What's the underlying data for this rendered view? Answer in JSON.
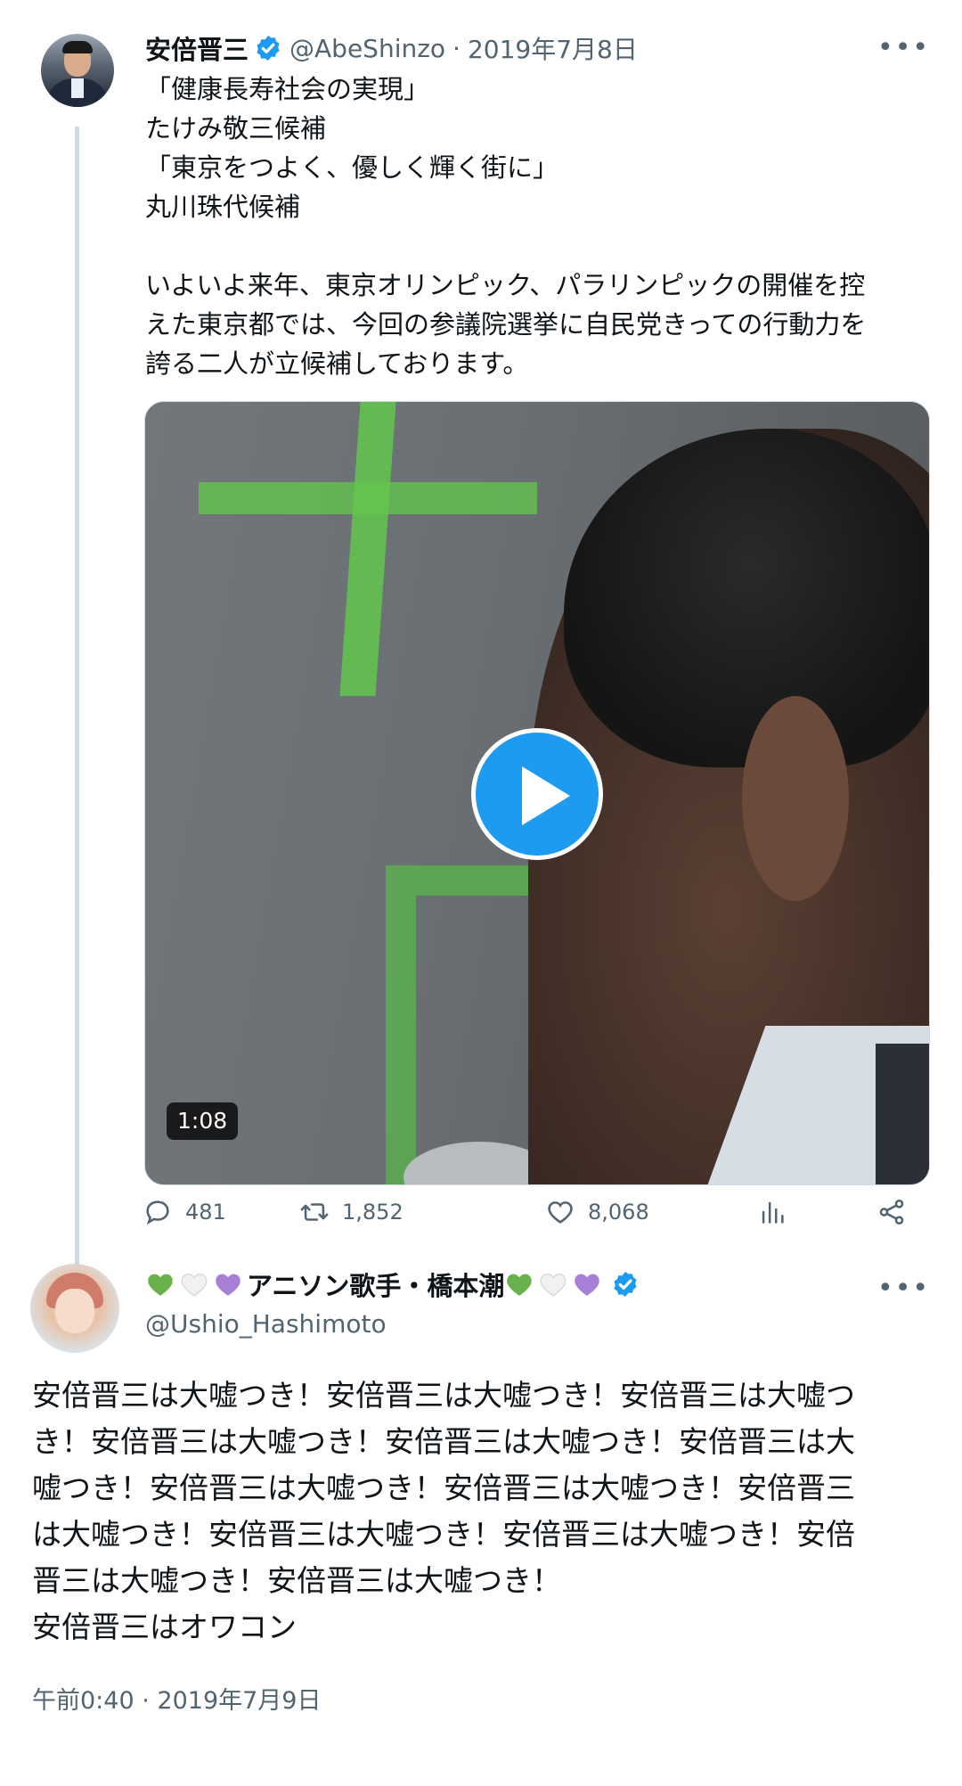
{
  "tweet1": {
    "author": {
      "name": "安倍晋三",
      "handle": "@AbeShinzo",
      "verified": true
    },
    "date": "2019年7月8日",
    "more_icon": "ellipsis-icon",
    "text_lines": [
      "「健康長寿社会の実現」",
      "たけみ敬三候補",
      "「東京をつよく、優しく輝く街に」",
      "丸川珠代候補",
      "",
      "いよいよ来年、東京オリンピック、パラリンピックの開催を控",
      "えた東京都では、今回の参議院選挙に自民党きっての行動力を",
      "誇る二人が立候補しております。"
    ],
    "video": {
      "duration": "1:08",
      "play_icon": "play-icon"
    },
    "actions": {
      "replies": "481",
      "retweets": "1,852",
      "likes": "8,068"
    }
  },
  "tweet2": {
    "author": {
      "name": "アニソン歌手・橋本潮",
      "name_emojis_before": [
        "green-heart",
        "white-heart",
        "purple-heart"
      ],
      "name_emojis_after": [
        "green-heart",
        "white-heart",
        "purple-heart"
      ],
      "handle": "@Ushio_Hashimoto",
      "verified": true
    },
    "text_lines": [
      "安倍晋三は大嘘つき！安倍晋三は大嘘つき！安倍晋三は大嘘つ",
      "き！安倍晋三は大嘘つき！安倍晋三は大嘘つき！安倍晋三は大",
      "嘘つき！安倍晋三は大嘘つき！安倍晋三は大嘘つき！安倍晋三",
      "は大嘘つき！安倍晋三は大嘘つき！安倍晋三は大嘘つき！安倍",
      "晋三は大嘘つき！安倍晋三は大嘘つき！",
      "安倍晋三はオワコン"
    ],
    "time": "午前0:40",
    "date": "2019年7月9日"
  },
  "colors": {
    "accent": "#1d9bf0",
    "secondary_text": "#536471",
    "primary_text": "#0f1419",
    "thread_line": "#cfd9de"
  }
}
